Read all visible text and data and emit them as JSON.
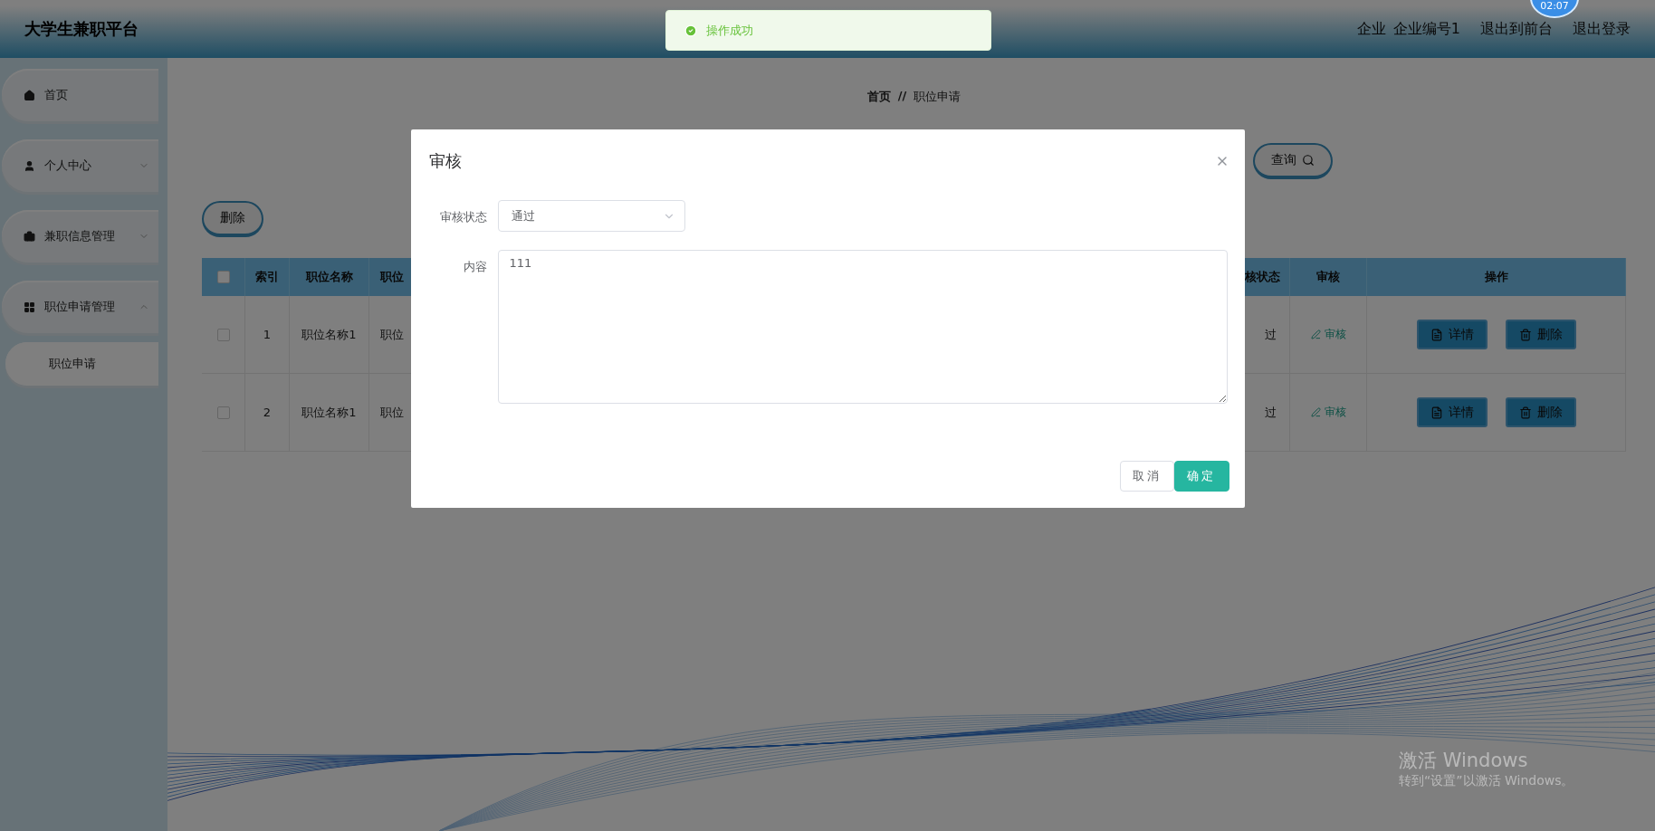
{
  "header": {
    "title": "大学生兼职平台",
    "role": "企业",
    "user": "企业编号1",
    "links": [
      "退出到前台",
      "退出登录"
    ]
  },
  "clock": "02:07",
  "toast": {
    "message": "操作成功"
  },
  "sidebar": {
    "items": [
      {
        "label": "首页",
        "kind": "link"
      },
      {
        "label": "个人中心",
        "kind": "menu",
        "expanded": false
      },
      {
        "label": "兼职信息管理",
        "kind": "menu",
        "expanded": false
      },
      {
        "label": "职位申请管理",
        "kind": "menu",
        "expanded": true,
        "children": [
          {
            "label": "职位申请",
            "selected": true
          }
        ]
      }
    ]
  },
  "breadcrumb": {
    "items": [
      "首页",
      "职位申请"
    ],
    "separator": "//"
  },
  "search_button": "查询",
  "delete_button": "删除",
  "table": {
    "all_checked": false,
    "columns": [
      "索引",
      "职位名称",
      "职位",
      "核状态",
      "审核",
      "操作"
    ],
    "rows": [
      {
        "checked": false,
        "cells": [
          "1",
          "职位名称1",
          "职位",
          "过"
        ],
        "review": "审核",
        "actions": [
          "详情",
          "删除"
        ]
      },
      {
        "checked": false,
        "cells": [
          "2",
          "职位名称1",
          "职位",
          "过"
        ],
        "review": "审核",
        "actions": [
          "详情",
          "删除"
        ]
      }
    ]
  },
  "dialog": {
    "title": "审核",
    "status_label": "审核状态",
    "status_value": "通过",
    "content_label": "内容",
    "content_value": "111",
    "buttons": [
      "取消",
      "确定"
    ]
  },
  "os_notice": {
    "title": "激活 Windows",
    "subtitle": "转到“设置”以激活 Windows。"
  }
}
